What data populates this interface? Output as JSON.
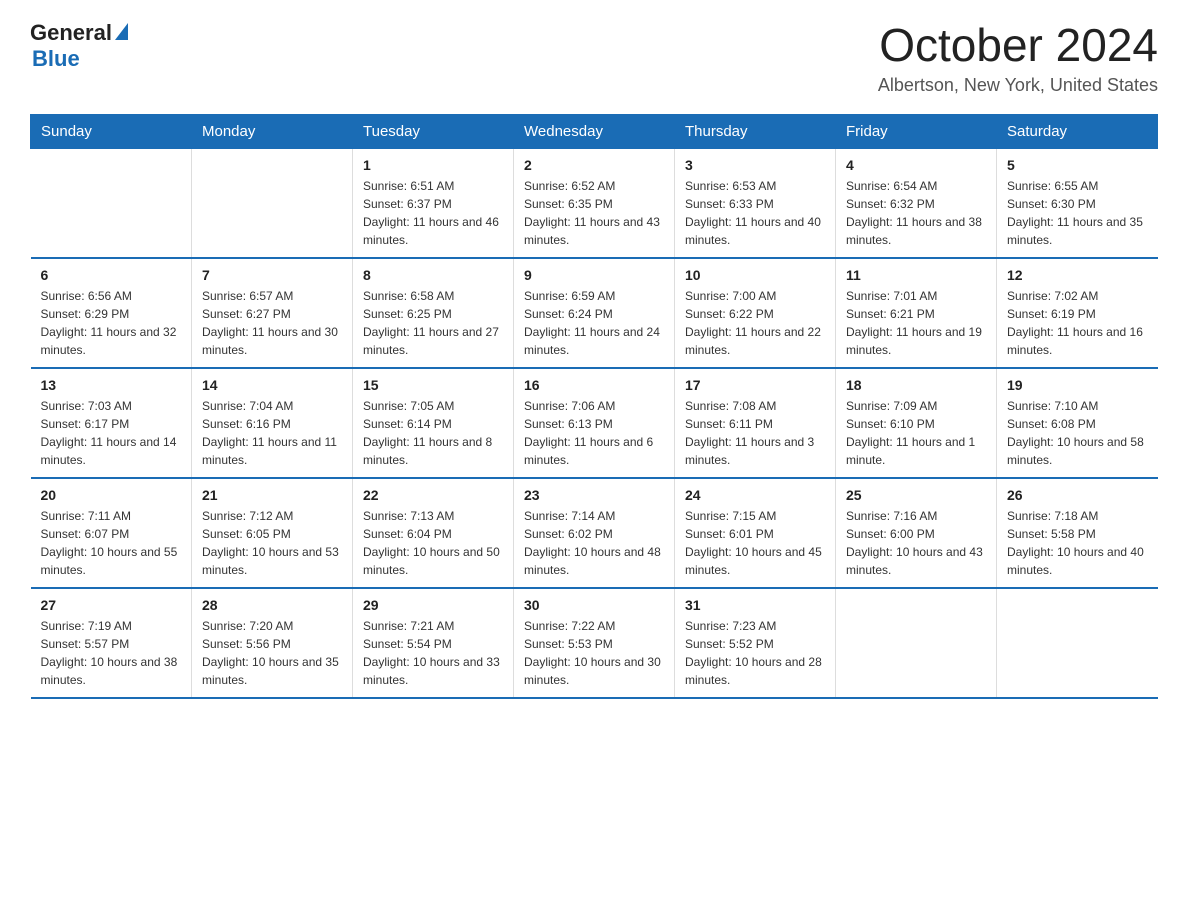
{
  "logo": {
    "text_general": "General",
    "text_blue": "Blue",
    "triangle": "▶"
  },
  "title": "October 2024",
  "subtitle": "Albertson, New York, United States",
  "days_of_week": [
    "Sunday",
    "Monday",
    "Tuesday",
    "Wednesday",
    "Thursday",
    "Friday",
    "Saturday"
  ],
  "weeks": [
    [
      {
        "day": "",
        "sunrise": "",
        "sunset": "",
        "daylight": ""
      },
      {
        "day": "",
        "sunrise": "",
        "sunset": "",
        "daylight": ""
      },
      {
        "day": "1",
        "sunrise": "Sunrise: 6:51 AM",
        "sunset": "Sunset: 6:37 PM",
        "daylight": "Daylight: 11 hours and 46 minutes."
      },
      {
        "day": "2",
        "sunrise": "Sunrise: 6:52 AM",
        "sunset": "Sunset: 6:35 PM",
        "daylight": "Daylight: 11 hours and 43 minutes."
      },
      {
        "day": "3",
        "sunrise": "Sunrise: 6:53 AM",
        "sunset": "Sunset: 6:33 PM",
        "daylight": "Daylight: 11 hours and 40 minutes."
      },
      {
        "day": "4",
        "sunrise": "Sunrise: 6:54 AM",
        "sunset": "Sunset: 6:32 PM",
        "daylight": "Daylight: 11 hours and 38 minutes."
      },
      {
        "day": "5",
        "sunrise": "Sunrise: 6:55 AM",
        "sunset": "Sunset: 6:30 PM",
        "daylight": "Daylight: 11 hours and 35 minutes."
      }
    ],
    [
      {
        "day": "6",
        "sunrise": "Sunrise: 6:56 AM",
        "sunset": "Sunset: 6:29 PM",
        "daylight": "Daylight: 11 hours and 32 minutes."
      },
      {
        "day": "7",
        "sunrise": "Sunrise: 6:57 AM",
        "sunset": "Sunset: 6:27 PM",
        "daylight": "Daylight: 11 hours and 30 minutes."
      },
      {
        "day": "8",
        "sunrise": "Sunrise: 6:58 AM",
        "sunset": "Sunset: 6:25 PM",
        "daylight": "Daylight: 11 hours and 27 minutes."
      },
      {
        "day": "9",
        "sunrise": "Sunrise: 6:59 AM",
        "sunset": "Sunset: 6:24 PM",
        "daylight": "Daylight: 11 hours and 24 minutes."
      },
      {
        "day": "10",
        "sunrise": "Sunrise: 7:00 AM",
        "sunset": "Sunset: 6:22 PM",
        "daylight": "Daylight: 11 hours and 22 minutes."
      },
      {
        "day": "11",
        "sunrise": "Sunrise: 7:01 AM",
        "sunset": "Sunset: 6:21 PM",
        "daylight": "Daylight: 11 hours and 19 minutes."
      },
      {
        "day": "12",
        "sunrise": "Sunrise: 7:02 AM",
        "sunset": "Sunset: 6:19 PM",
        "daylight": "Daylight: 11 hours and 16 minutes."
      }
    ],
    [
      {
        "day": "13",
        "sunrise": "Sunrise: 7:03 AM",
        "sunset": "Sunset: 6:17 PM",
        "daylight": "Daylight: 11 hours and 14 minutes."
      },
      {
        "day": "14",
        "sunrise": "Sunrise: 7:04 AM",
        "sunset": "Sunset: 6:16 PM",
        "daylight": "Daylight: 11 hours and 11 minutes."
      },
      {
        "day": "15",
        "sunrise": "Sunrise: 7:05 AM",
        "sunset": "Sunset: 6:14 PM",
        "daylight": "Daylight: 11 hours and 8 minutes."
      },
      {
        "day": "16",
        "sunrise": "Sunrise: 7:06 AM",
        "sunset": "Sunset: 6:13 PM",
        "daylight": "Daylight: 11 hours and 6 minutes."
      },
      {
        "day": "17",
        "sunrise": "Sunrise: 7:08 AM",
        "sunset": "Sunset: 6:11 PM",
        "daylight": "Daylight: 11 hours and 3 minutes."
      },
      {
        "day": "18",
        "sunrise": "Sunrise: 7:09 AM",
        "sunset": "Sunset: 6:10 PM",
        "daylight": "Daylight: 11 hours and 1 minute."
      },
      {
        "day": "19",
        "sunrise": "Sunrise: 7:10 AM",
        "sunset": "Sunset: 6:08 PM",
        "daylight": "Daylight: 10 hours and 58 minutes."
      }
    ],
    [
      {
        "day": "20",
        "sunrise": "Sunrise: 7:11 AM",
        "sunset": "Sunset: 6:07 PM",
        "daylight": "Daylight: 10 hours and 55 minutes."
      },
      {
        "day": "21",
        "sunrise": "Sunrise: 7:12 AM",
        "sunset": "Sunset: 6:05 PM",
        "daylight": "Daylight: 10 hours and 53 minutes."
      },
      {
        "day": "22",
        "sunrise": "Sunrise: 7:13 AM",
        "sunset": "Sunset: 6:04 PM",
        "daylight": "Daylight: 10 hours and 50 minutes."
      },
      {
        "day": "23",
        "sunrise": "Sunrise: 7:14 AM",
        "sunset": "Sunset: 6:02 PM",
        "daylight": "Daylight: 10 hours and 48 minutes."
      },
      {
        "day": "24",
        "sunrise": "Sunrise: 7:15 AM",
        "sunset": "Sunset: 6:01 PM",
        "daylight": "Daylight: 10 hours and 45 minutes."
      },
      {
        "day": "25",
        "sunrise": "Sunrise: 7:16 AM",
        "sunset": "Sunset: 6:00 PM",
        "daylight": "Daylight: 10 hours and 43 minutes."
      },
      {
        "day": "26",
        "sunrise": "Sunrise: 7:18 AM",
        "sunset": "Sunset: 5:58 PM",
        "daylight": "Daylight: 10 hours and 40 minutes."
      }
    ],
    [
      {
        "day": "27",
        "sunrise": "Sunrise: 7:19 AM",
        "sunset": "Sunset: 5:57 PM",
        "daylight": "Daylight: 10 hours and 38 minutes."
      },
      {
        "day": "28",
        "sunrise": "Sunrise: 7:20 AM",
        "sunset": "Sunset: 5:56 PM",
        "daylight": "Daylight: 10 hours and 35 minutes."
      },
      {
        "day": "29",
        "sunrise": "Sunrise: 7:21 AM",
        "sunset": "Sunset: 5:54 PM",
        "daylight": "Daylight: 10 hours and 33 minutes."
      },
      {
        "day": "30",
        "sunrise": "Sunrise: 7:22 AM",
        "sunset": "Sunset: 5:53 PM",
        "daylight": "Daylight: 10 hours and 30 minutes."
      },
      {
        "day": "31",
        "sunrise": "Sunrise: 7:23 AM",
        "sunset": "Sunset: 5:52 PM",
        "daylight": "Daylight: 10 hours and 28 minutes."
      },
      {
        "day": "",
        "sunrise": "",
        "sunset": "",
        "daylight": ""
      },
      {
        "day": "",
        "sunrise": "",
        "sunset": "",
        "daylight": ""
      }
    ]
  ]
}
